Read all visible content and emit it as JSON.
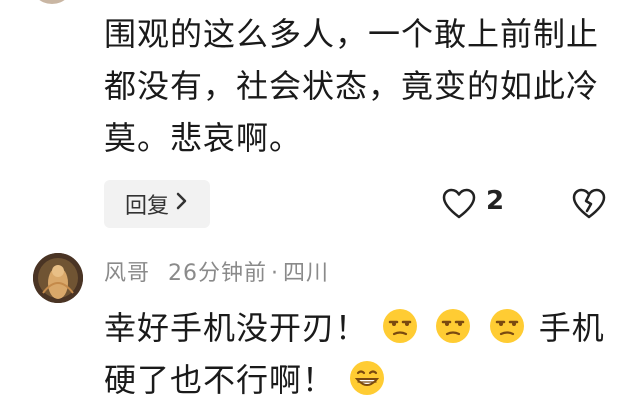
{
  "comment1": {
    "text": "围观的这么多人，一个敢上前制止都没有，社会状态，竟变的如此冷莫。悲哀啊。",
    "reply_label": "回复",
    "like_count": "2"
  },
  "comment2": {
    "author": "风哥",
    "time": "26分钟前",
    "location": "四川",
    "text_part1": "幸好手机没开刃！",
    "text_part2": "手机硬了也不行啊！",
    "emojis": [
      "unamused-face-icon",
      "unamused-face-icon",
      "unamused-face-icon",
      "grinning-face-icon"
    ]
  },
  "colors": {
    "text": "#1a1a1a",
    "meta": "#8a8a8a",
    "reply_bg": "#f2f2f2",
    "emoji_yellow": "#ffcc33"
  }
}
